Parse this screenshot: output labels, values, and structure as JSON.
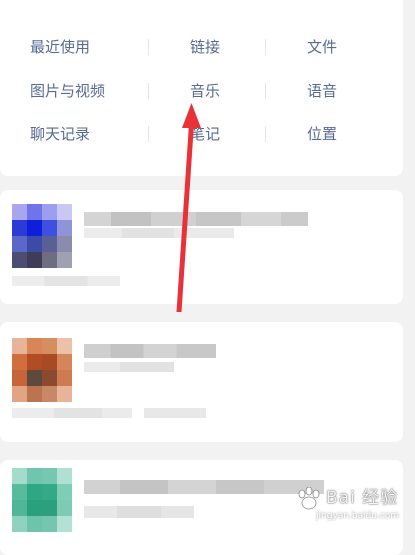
{
  "categories": [
    {
      "label": "最近使用"
    },
    {
      "label": "链接"
    },
    {
      "label": "文件"
    },
    {
      "label": "图片与视频"
    },
    {
      "label": "音乐"
    },
    {
      "label": "语音"
    },
    {
      "label": "聊天记录"
    },
    {
      "label": "笔记"
    },
    {
      "label": "位置"
    }
  ],
  "watermark": {
    "title": "Bai 经验",
    "url": "jingyan.baidu.com"
  },
  "colors": {
    "category_text": "#576b95",
    "arrow": "#e8323a",
    "background": "#f2f2f2"
  },
  "results": [
    {
      "avatar": "blurred-blue-avatar"
    },
    {
      "avatar": "blurred-orange-avatar"
    },
    {
      "avatar": "blurred-teal-avatar"
    }
  ]
}
